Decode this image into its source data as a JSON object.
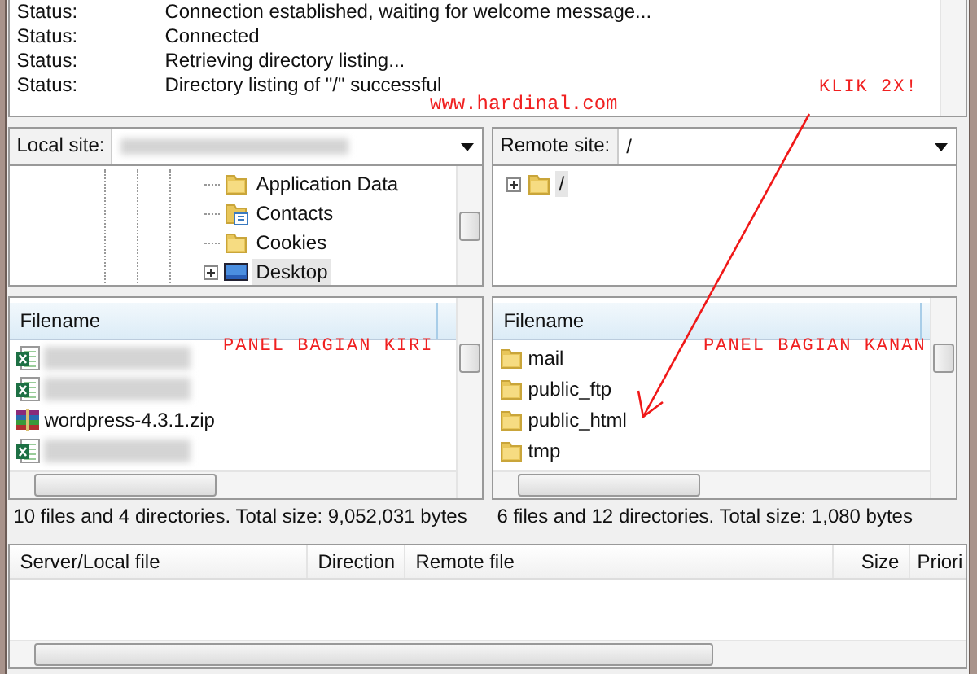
{
  "message_log": [
    {
      "label": "Status:",
      "message": "Connection established, waiting for welcome message..."
    },
    {
      "label": "Status:",
      "message": "Connected"
    },
    {
      "label": "Status:",
      "message": "Retrieving directory listing..."
    },
    {
      "label": "Status:",
      "message": "Directory listing of \"/\" successful"
    }
  ],
  "local_site": {
    "label": "Local site:",
    "path_redacted": true,
    "tree": [
      {
        "name": "Application Data",
        "kind": "folder",
        "expandable": false,
        "selected": false
      },
      {
        "name": "Contacts",
        "kind": "contacts",
        "expandable": false,
        "selected": false
      },
      {
        "name": "Cookies",
        "kind": "folder",
        "expandable": false,
        "selected": false
      },
      {
        "name": "Desktop",
        "kind": "desktop",
        "expandable": true,
        "selected": true
      }
    ],
    "column": "Filename",
    "files": [
      {
        "kind": "spreadsheet",
        "redacted": true
      },
      {
        "kind": "spreadsheet",
        "redacted": true
      },
      {
        "kind": "archive",
        "redacted": false,
        "name": "wordpress-4.3.1.zip"
      },
      {
        "kind": "spreadsheet",
        "redacted": true
      }
    ],
    "status": "10 files and 4 directories. Total size: 9,052,031 bytes"
  },
  "remote_site": {
    "label": "Remote site:",
    "path": "/",
    "tree": [
      {
        "name": "/",
        "kind": "folder",
        "expandable": true,
        "selected": true
      }
    ],
    "column": "Filename",
    "files": [
      {
        "kind": "folder",
        "redacted": false,
        "name": "mail"
      },
      {
        "kind": "folder",
        "redacted": false,
        "name": "public_ftp"
      },
      {
        "kind": "folder",
        "redacted": false,
        "name": "public_html"
      },
      {
        "kind": "folder",
        "redacted": false,
        "name": "tmp"
      }
    ],
    "status": "6 files and 12 directories. Total size: 1,080 bytes"
  },
  "queue": {
    "columns": [
      "Server/Local file",
      "Direction",
      "Remote file",
      "Size",
      "Priori"
    ]
  },
  "annotations": {
    "watermark": "www.hardinal.com",
    "callout": "KLIK 2X!",
    "left_label": "PANEL BAGIAN KIRI",
    "right_label": "PANEL BAGIAN KANAN"
  }
}
